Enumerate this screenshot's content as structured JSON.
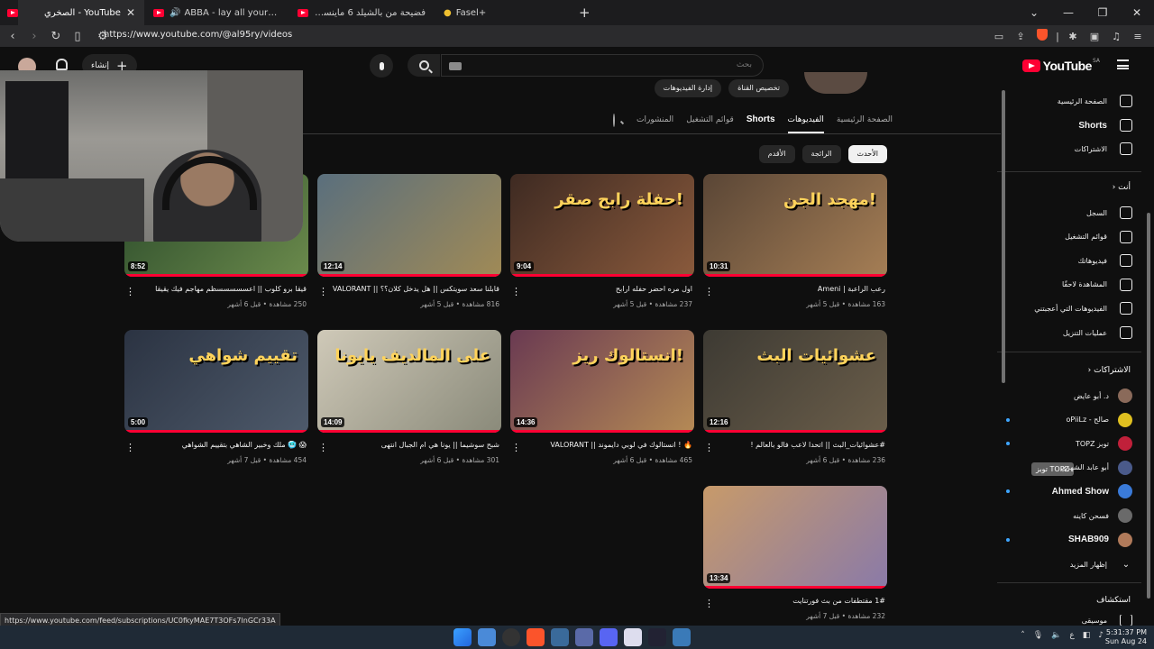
{
  "browser": {
    "tabs": [
      {
        "title": "YouTube - الصخري",
        "active": true,
        "close": "✕"
      },
      {
        "title": "ABBA - lay all your love on me (S",
        "active": false,
        "close": ""
      },
      {
        "title": "فضيحة من بالشيلد 6 ماينسكت عنهاء - ",
        "active": false,
        "close": ""
      },
      {
        "title": "Fasel+",
        "active": false,
        "close": ""
      }
    ],
    "new_tab": "+",
    "url": "https://www.youtube.com/@al95ry/videos",
    "status_url": "https://www.youtube.com/feed/subscriptions/UC0fkyMAE7T3OFs7lnGCr33A"
  },
  "youtube": {
    "logo_text": "YouTube",
    "country": "SA",
    "search_placeholder": "بحث",
    "create_label": "إنشاء"
  },
  "channel": {
    "banner_buttons": [
      "تخصيص القناة",
      "إدارة الفيديوهات"
    ],
    "tabs": [
      {
        "label": "الصفحة الرئيسية",
        "selected": false
      },
      {
        "label": "الفيديوهات",
        "selected": true
      },
      {
        "label": "Shorts",
        "selected": false
      },
      {
        "label": "قوائم التشغيل",
        "selected": false
      },
      {
        "label": "المنشورات",
        "selected": false
      }
    ],
    "chips": [
      {
        "label": "الأحدث",
        "selected": true
      },
      {
        "label": "الرائجة",
        "selected": false
      },
      {
        "label": "الأقدم",
        "selected": false
      }
    ]
  },
  "videos": [
    {
      "title": "رعب الراعبة | Ameni",
      "meta": "163 مشاهدة • قبل 5 أشهر",
      "duration": "10:31",
      "thumb_text": "مهجد الجن!",
      "colors": [
        "#5a4636",
        "#a57e55"
      ]
    },
    {
      "title": "اول مره احضر حفله ارابح",
      "meta": "237 مشاهدة • قبل 5 أشهر",
      "duration": "9:04",
      "thumb_text": "حفلة رابح صقر!",
      "colors": [
        "#3e2a22",
        "#8a5a3c"
      ]
    },
    {
      "title": "قابلنا سعد سويتكس || هل يدخل كلان؟؟ || VALORANT",
      "meta": "816 مشاهدة • قبل 5 أشهر",
      "duration": "12:14",
      "thumb_text": "",
      "colors": [
        "#5a6f7d",
        "#a08a56"
      ]
    },
    {
      "title": "قيقا برو كلوب || اعسسسسسظم مهاجم فيك يقيقا",
      "meta": "250 مشاهدة • قبل 6 أشهر",
      "duration": "8:52",
      "thumb_text": "",
      "colors": [
        "#2a4a2a",
        "#6b8a4c"
      ]
    },
    {
      "title": "#عشوائيات_البث || اتحدا لاعب فالو بالعالم !",
      "meta": "236 مشاهدة • قبل 6 أشهر",
      "duration": "12:16",
      "thumb_text": "عشوائيات البث",
      "colors": [
        "#3d3a33",
        "#6b5e4a"
      ]
    },
    {
      "title": "🔥 ! انستالوك في لوبي دايموند || VALORANT",
      "meta": "465 مشاهدة • قبل 6 أشهر",
      "duration": "14:36",
      "thumb_text": "انستالوك ريز!",
      "colors": [
        "#6a3a52",
        "#b58a55"
      ]
    },
    {
      "title": "شبح سوشيما || يونا هي ام الجبال انتهى",
      "meta": "301 مشاهدة • قبل 6 أشهر",
      "duration": "14:09",
      "thumb_text": "على المالديف يايونا",
      "colors": [
        "#cfc9b8",
        "#8a8a7a"
      ]
    },
    {
      "title": "😱 🥶 ملك وخبير الشاهي بتقييم الشواهي",
      "meta": "454 مشاهدة • قبل 7 أشهر",
      "duration": "5:00",
      "thumb_text": "تقييم شواهي",
      "colors": [
        "#2b3342",
        "#4e5a6b"
      ]
    },
    {
      "title": "1# مقتطفات من بث فورتنايت",
      "meta": "232 مشاهدة • قبل 7 أشهر",
      "duration": "13:34",
      "thumb_text": "",
      "colors": [
        "#c79a6a",
        "#8a7aa8"
      ]
    }
  ],
  "sidebar": {
    "main": [
      {
        "label": "الصفحة الرئيسية",
        "icon": "home-icon",
        "bold": false
      },
      {
        "label": "Shorts",
        "icon": "shorts-icon",
        "bold": true
      },
      {
        "label": "الاشتراكات",
        "icon": "subscriptions-icon",
        "bold": false
      }
    ],
    "you_header": "أنت",
    "you": [
      {
        "label": "السجل",
        "icon": "history-icon"
      },
      {
        "label": "قوائم التشغيل",
        "icon": "playlists-icon"
      },
      {
        "label": "فيديوهاتك",
        "icon": "your-videos-icon"
      },
      {
        "label": "المشاهدة لاحقًا",
        "icon": "watch-later-icon"
      },
      {
        "label": "الفيديوهات التي أعجبتني",
        "icon": "liked-icon"
      },
      {
        "label": "عمليات التنزيل",
        "icon": "download-icon"
      }
    ],
    "subs_header": "الاشتراكات",
    "subs": [
      {
        "label": "د. أبو عايض",
        "color": "#8a6a5a",
        "dot": false,
        "bold": false
      },
      {
        "label": "صالح - oPiiLz",
        "color": "#e0c020",
        "dot": true,
        "bold": false
      },
      {
        "label": "توبز TOPZ",
        "color": "#c0203a",
        "dot": true,
        "bold": false
      },
      {
        "label": "أبو عابد الشهري",
        "color": "#4a5a8a",
        "dot": false,
        "bold": false
      },
      {
        "label": "Ahmed Show",
        "color": "#3a7ad8",
        "dot": true,
        "bold": true
      },
      {
        "label": "فسحن كاينه",
        "color": "#6a6a6a",
        "dot": false,
        "bold": false
      },
      {
        "label": "SHAB909",
        "color": "#b07a5a",
        "dot": true,
        "bold": true
      }
    ],
    "show_more": "إظهار المزيد",
    "explore_header": "استكشاف",
    "explore_partial": "موسيقى",
    "tooltip": "توبز TOPZ"
  },
  "taskbar": {
    "lang": "ع",
    "time": "5:31:37 PM",
    "date": "Sun Aug 24"
  }
}
